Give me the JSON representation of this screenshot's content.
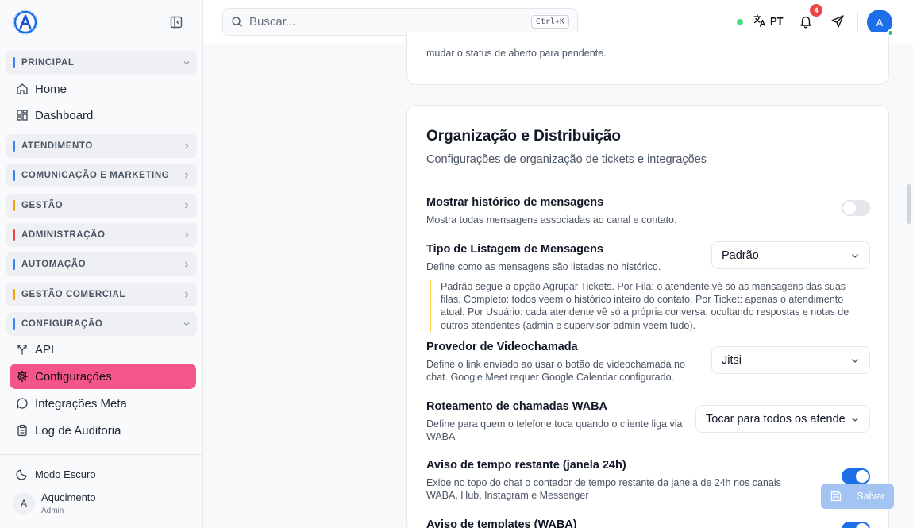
{
  "sidebar": {
    "sections": [
      {
        "label": "PRINCIPAL",
        "color": "#3b82f6",
        "expanded": true
      },
      {
        "label": "ATENDIMENTO",
        "color": "#3b82f6",
        "expanded": false
      },
      {
        "label": "COMUNICAÇÃO E MARKETING",
        "color": "#3b82f6",
        "expanded": false
      },
      {
        "label": "GESTÃO",
        "color": "#f59e0b",
        "expanded": false
      },
      {
        "label": "ADMINISTRAÇÃO",
        "color": "#ef4444",
        "expanded": false
      },
      {
        "label": "AUTOMAÇÃO",
        "color": "#3b82f6",
        "expanded": false
      },
      {
        "label": "GESTÃO COMERCIAL",
        "color": "#f59e0b",
        "expanded": false
      },
      {
        "label": "CONFIGURAÇÃO",
        "color": "#3b82f6",
        "expanded": true
      }
    ],
    "principal_items": [
      {
        "label": "Home",
        "icon": "home-icon"
      },
      {
        "label": "Dashboard",
        "icon": "dashboard-icon"
      }
    ],
    "config_items": [
      {
        "label": "API",
        "icon": "api-icon"
      },
      {
        "label": "Configurações",
        "icon": "gear-icon",
        "active": true
      },
      {
        "label": "Integrações Meta",
        "icon": "chat-icon"
      },
      {
        "label": "Log de Auditoria",
        "icon": "clipboard-icon"
      }
    ],
    "dark_mode_label": "Modo Escuro",
    "user": {
      "initial": "A",
      "name": "Aqucimento",
      "role": "Admin"
    }
  },
  "header": {
    "search_placeholder": "Buscar...",
    "search_shortcut": "Ctrl+K",
    "language": "PT",
    "notification_count": "4",
    "avatar_initial": "A"
  },
  "main": {
    "top_card_text": "mudar o status de aberto para pendente.",
    "card": {
      "title": "Organização e Distribuição",
      "subtitle": "Configurações de organização de tickets e integrações",
      "settings": [
        {
          "title": "Mostrar histórico de mensagens",
          "desc": "Mostra todas mensagens associadas ao canal e contato.",
          "toggle": false
        },
        {
          "title": "Tipo de Listagem de Mensagens",
          "desc": "Define como as mensagens são listadas no histórico.",
          "select": "Padrão"
        },
        {
          "title": "Provedor de Videochamada",
          "desc": "Define o link enviado ao usar o botão de videochamada no chat. Google Meet requer Google Calendar configurado.",
          "select": "Jitsi"
        },
        {
          "title": "Roteamento de chamadas WABA",
          "desc": "Define para quem o telefone toca quando o cliente liga via WABA",
          "select": "Tocar para todos os atende"
        },
        {
          "title": "Aviso de tempo restante (janela 24h)",
          "desc": "Exibe no topo do chat o contador de tempo restante da janela de 24h nos canais WABA, Hub, Instagram e Messenger",
          "toggle": true
        },
        {
          "title": "Aviso de templates (WABA)",
          "toggle": true
        }
      ],
      "note": "Padrão segue a opção Agrupar Tickets. Por Fila: o atendente vê só as mensagens das suas filas. Completo: todos veem o histórico inteiro do contato. Por Ticket: apenas o atendimento atual. Por Usuário: cada atendente vê só a própria conversa, ocultando respostas e notas de outros atendentes (admin e supervisor-admin veem tudo)."
    },
    "save_label": "Salvar"
  }
}
